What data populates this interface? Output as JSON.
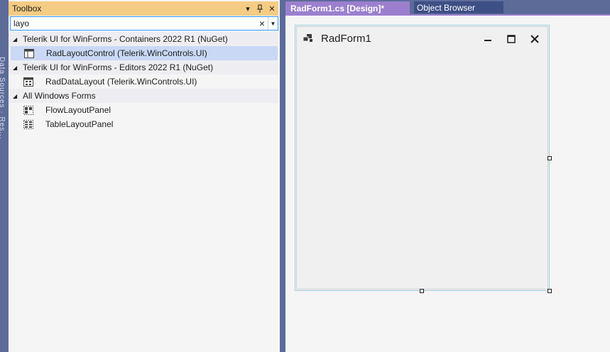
{
  "side_strip": {
    "text": "Data Sources  ·  Res..."
  },
  "toolbox": {
    "title": "Toolbox",
    "search": {
      "value": "layo",
      "placeholder": ""
    },
    "groups": [
      {
        "label": "Telerik UI for WinForms - Containers 2022 R1 (NuGet)",
        "items": [
          {
            "label": "RadLayoutControl (Telerik.WinControls.UI)",
            "icon": "layout-control-icon",
            "selected": true
          }
        ]
      },
      {
        "label": "Telerik UI for WinForms - Editors 2022 R1 (NuGet)",
        "items": [
          {
            "label": "RadDataLayout (Telerik.WinControls.UI)",
            "icon": "data-layout-icon",
            "selected": false
          }
        ]
      },
      {
        "label": "All Windows Forms",
        "items": [
          {
            "label": "FlowLayoutPanel",
            "icon": "flow-layout-icon",
            "selected": false
          },
          {
            "label": "TableLayoutPanel",
            "icon": "table-layout-icon",
            "selected": false
          }
        ]
      }
    ]
  },
  "tabs": {
    "design": "RadForm1.cs [Design]*",
    "object_browser": "Object Browser"
  },
  "form": {
    "title": "RadForm1"
  },
  "colors": {
    "header_bg": "#f5cc84",
    "active_tab": "#9b7fce",
    "inactive_tab": "#3e4f85",
    "frame": "#5d6b99",
    "selected_item": "#c9d8f5"
  }
}
